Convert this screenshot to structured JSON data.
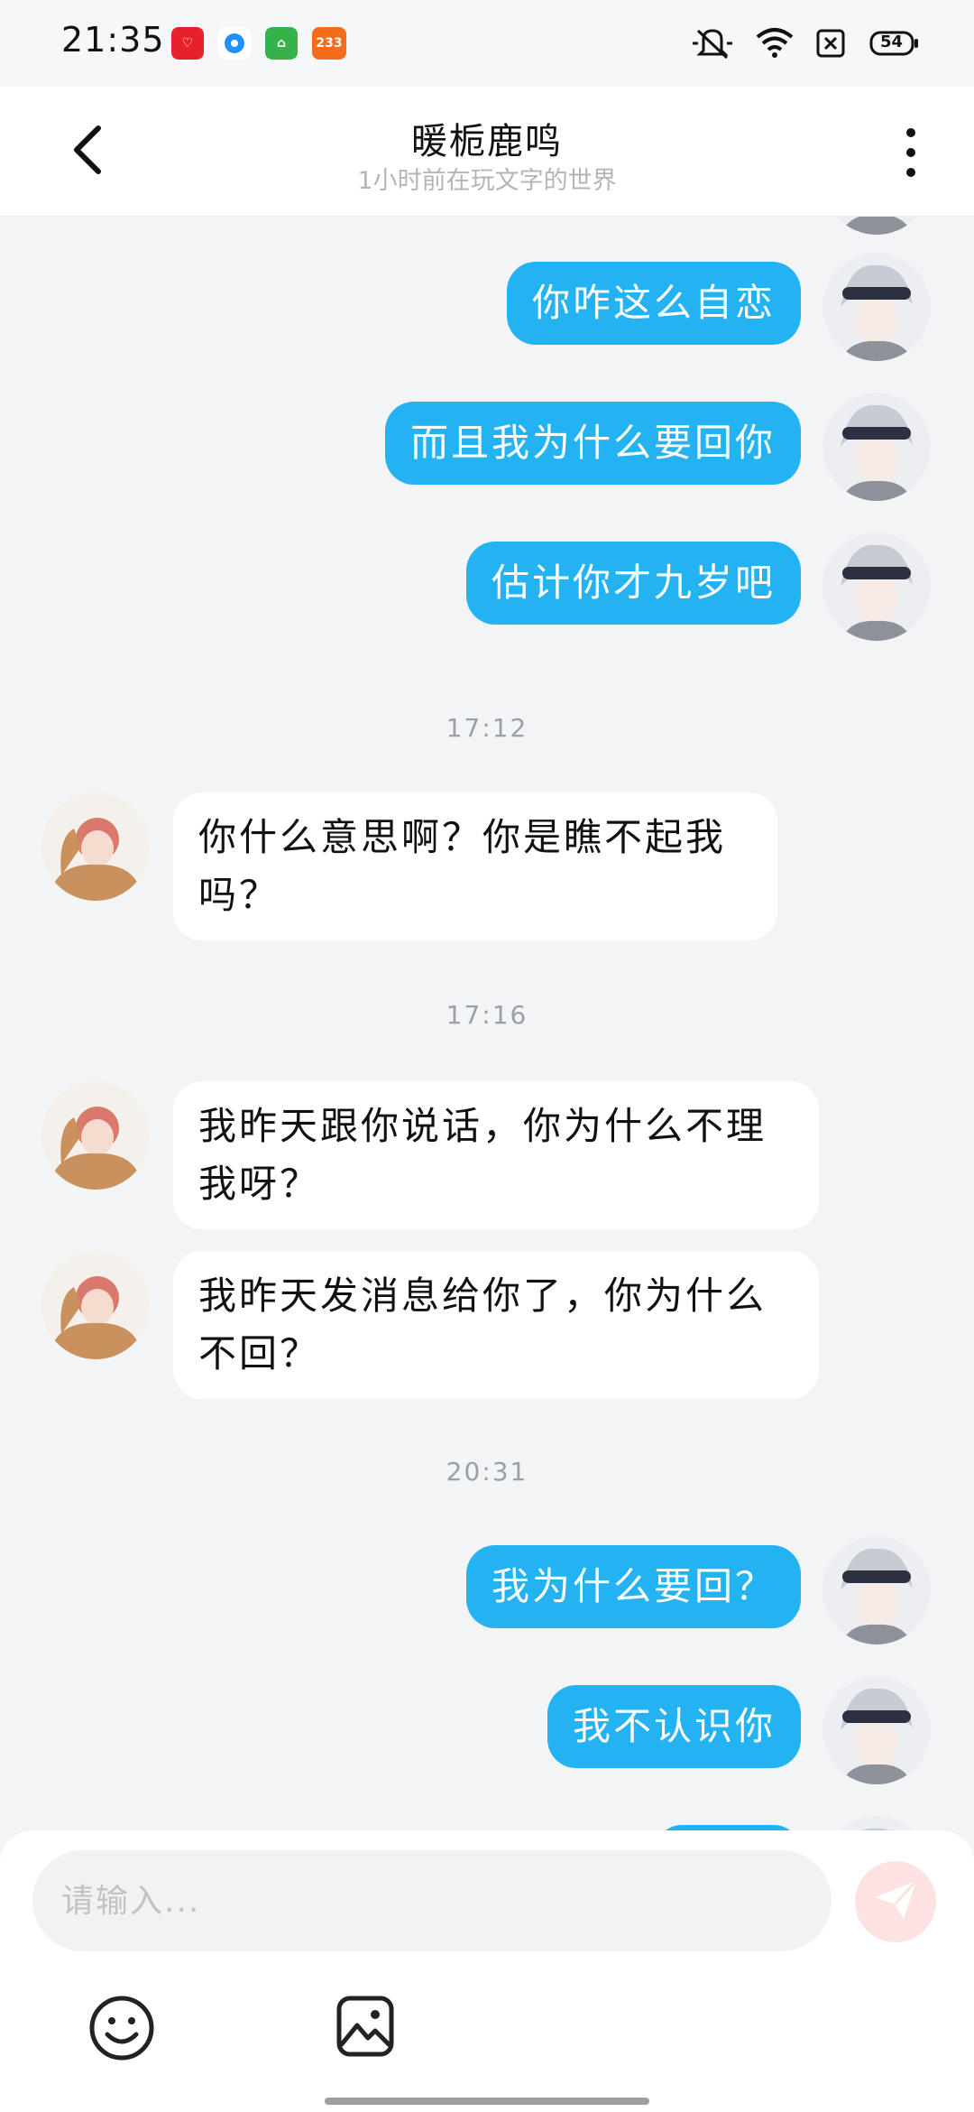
{
  "status_bar": {
    "time": "21:35",
    "notification_badge": "233",
    "battery_level": "54"
  },
  "header": {
    "title": "暖栀鹿鸣",
    "subtitle": "1小时前在玩文字的世界"
  },
  "messages": [
    {
      "type": "message",
      "from": "me",
      "text": "你咋这么自恋"
    },
    {
      "type": "message",
      "from": "me",
      "text": "而且我为什么要回你"
    },
    {
      "type": "message",
      "from": "me",
      "text": "估计你才九岁吧"
    },
    {
      "type": "timestamp",
      "text": "17:12"
    },
    {
      "type": "message",
      "from": "other",
      "text": "你什么意思啊？你是瞧不起我吗？"
    },
    {
      "type": "timestamp",
      "text": "17:16"
    },
    {
      "type": "message",
      "from": "other",
      "text": "我昨天跟你说话，你为什么不理我呀？"
    },
    {
      "type": "message",
      "from": "other",
      "text": "我昨天发消息给你了，你为什么不回？"
    },
    {
      "type": "timestamp",
      "text": "20:31"
    },
    {
      "type": "message",
      "from": "me",
      "text": "我为什么要回？"
    },
    {
      "type": "message",
      "from": "me",
      "text": "我不认识你"
    }
  ],
  "input": {
    "placeholder": "请输入..."
  },
  "icons": {
    "back": "chevron-left-icon",
    "more": "more-vertical-icon",
    "send": "send-icon",
    "emoji": "smiley-icon",
    "image": "image-icon"
  },
  "colors": {
    "my_bubble": "#23b3f3",
    "other_bubble": "#ffffff",
    "background": "#f3f4f6",
    "send_button": "#fde2e2"
  }
}
